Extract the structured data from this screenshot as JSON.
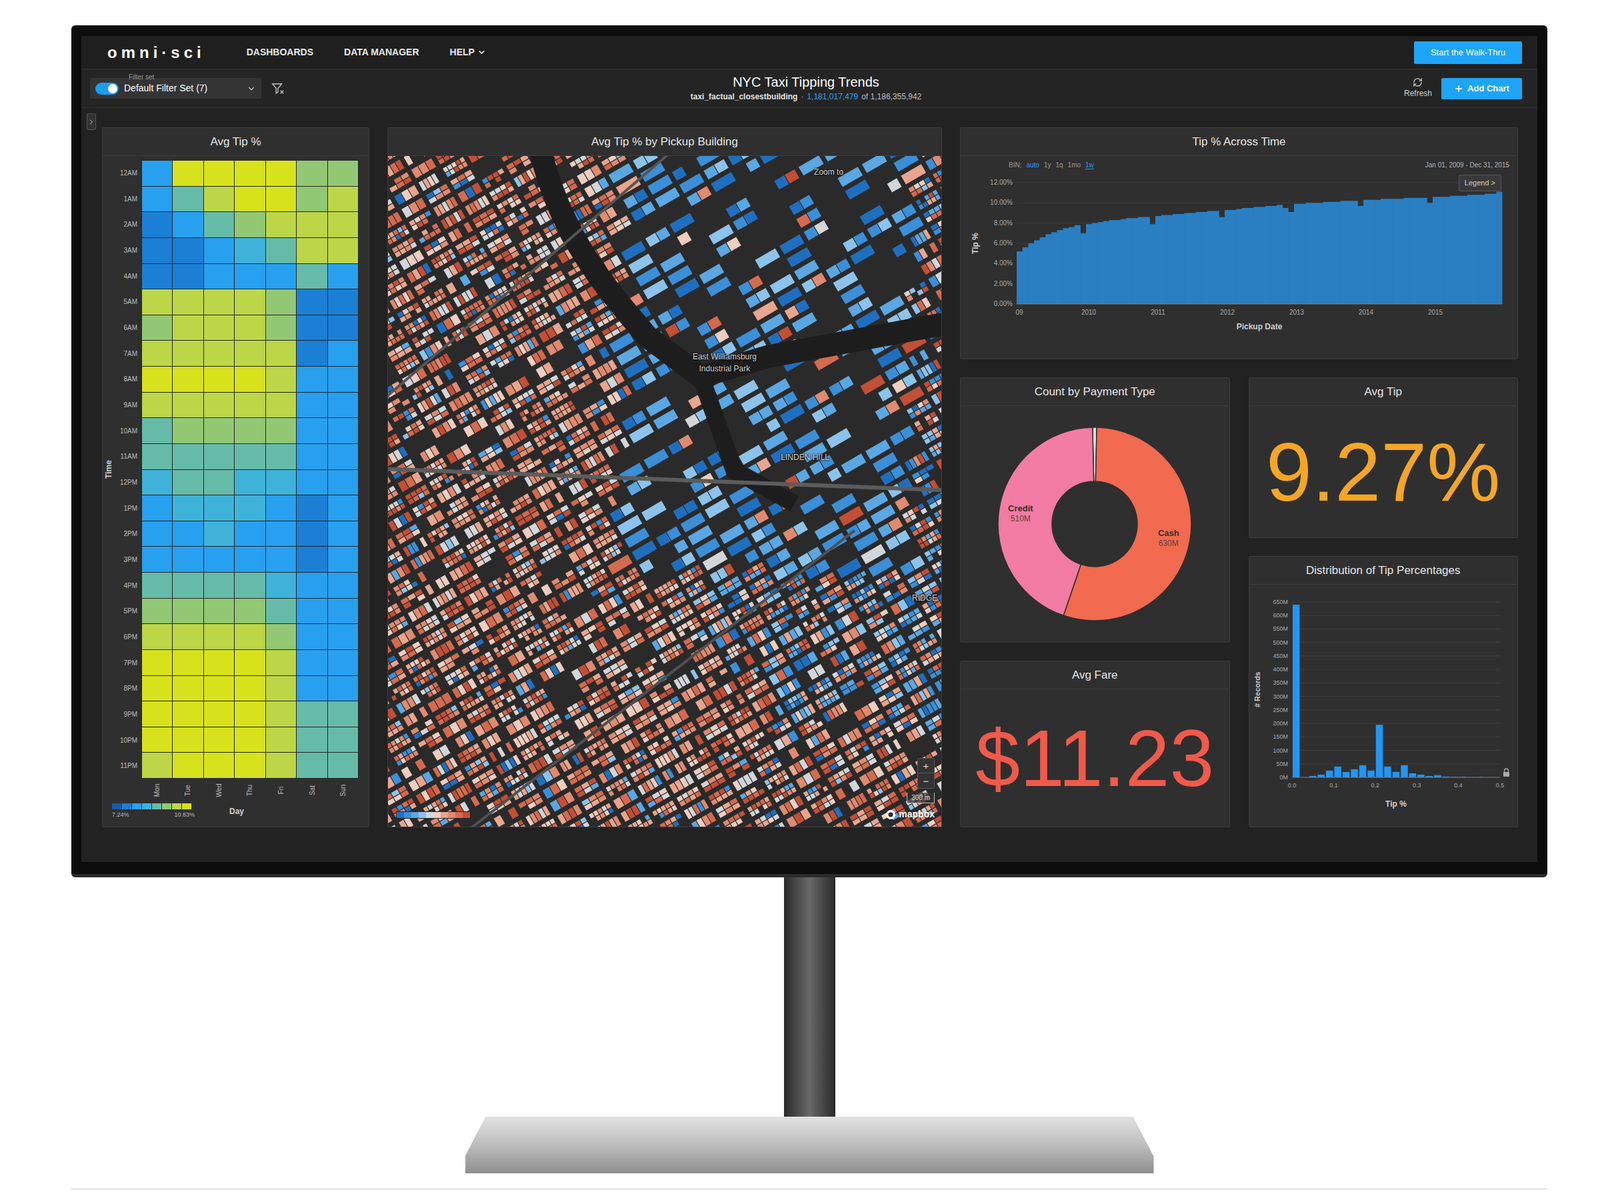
{
  "nav": {
    "logo": "omni·sci",
    "items": [
      {
        "label": "DASHBOARDS",
        "has_menu": false
      },
      {
        "label": "DATA MANAGER",
        "has_menu": false
      },
      {
        "label": "HELP",
        "has_menu": true
      }
    ],
    "walkthru_button": "Start the Walk-Thru"
  },
  "filter_bar": {
    "filter_set_label": "Filter set",
    "filter_set": "Default Filter Set (7)",
    "toggle_on": true,
    "title": "NYC Taxi Tipping Trends",
    "subtitle": {
      "table": "taxi_factual_closestbuilding",
      "separator": "·",
      "filtered": "1,181,017,479",
      "of_total": "of 1,186,355,942"
    },
    "refresh": "Refresh",
    "add_chart": "Add Chart"
  },
  "heatmap": {
    "title": "Avg Tip %",
    "y_label": "Time",
    "x_label": "Day",
    "range": [
      7.24,
      10.83
    ],
    "hours": [
      "12AM",
      "1AM",
      "2AM",
      "3AM",
      "4AM",
      "5AM",
      "6AM",
      "7AM",
      "8AM",
      "9AM",
      "10AM",
      "11AM",
      "12PM",
      "1PM",
      "2PM",
      "3PM",
      "4PM",
      "5PM",
      "6PM",
      "7PM",
      "8PM",
      "9PM",
      "10PM",
      "11PM"
    ],
    "days": [
      "Mon",
      "Tue",
      "Wed",
      "Thu",
      "Fri",
      "Sat",
      "Sun"
    ],
    "values": [
      [
        8.32,
        10.65,
        10.65,
        10.65,
        10.65,
        9.93,
        9.57
      ],
      [
        8.32,
        9.21,
        10.29,
        10.65,
        10.65,
        9.75,
        10.47
      ],
      [
        7.96,
        8.32,
        9.39,
        9.57,
        10.11,
        10.47,
        10.47
      ],
      [
        7.6,
        7.96,
        8.32,
        8.86,
        9.39,
        10.11,
        10.47
      ],
      [
        7.78,
        7.96,
        8.14,
        8.32,
        8.5,
        9.21,
        8.32
      ],
      [
        10.11,
        10.11,
        10.11,
        10.11,
        9.57,
        7.78,
        7.78
      ],
      [
        9.75,
        10.11,
        10.29,
        10.11,
        9.75,
        7.78,
        7.96
      ],
      [
        10.29,
        10.47,
        10.47,
        10.47,
        10.29,
        7.96,
        8.14
      ],
      [
        10.65,
        10.65,
        10.65,
        10.65,
        10.47,
        8.32,
        8.32
      ],
      [
        10.47,
        10.47,
        10.47,
        10.47,
        10.29,
        8.32,
        8.32
      ],
      [
        9.39,
        9.93,
        9.93,
        9.75,
        9.75,
        8.32,
        8.32
      ],
      [
        9.04,
        9.39,
        9.39,
        9.21,
        9.04,
        8.32,
        8.32
      ],
      [
        8.86,
        9.04,
        9.04,
        8.86,
        8.68,
        8.14,
        8.32
      ],
      [
        8.5,
        8.68,
        8.68,
        8.68,
        8.32,
        7.96,
        8.32
      ],
      [
        8.32,
        8.5,
        8.68,
        8.5,
        8.14,
        7.78,
        8.32
      ],
      [
        8.32,
        8.14,
        8.5,
        8.5,
        8.32,
        7.96,
        8.32
      ],
      [
        9.39,
        9.04,
        9.04,
        9.21,
        8.68,
        8.14,
        8.32
      ],
      [
        9.93,
        9.75,
        9.75,
        9.75,
        9.39,
        8.14,
        8.32
      ],
      [
        10.29,
        10.29,
        10.29,
        10.29,
        9.93,
        8.32,
        8.32
      ],
      [
        10.65,
        10.65,
        10.65,
        10.65,
        10.29,
        8.32,
        8.32
      ],
      [
        10.65,
        10.65,
        10.65,
        10.65,
        10.29,
        8.5,
        8.32
      ],
      [
        10.65,
        10.65,
        10.65,
        10.65,
        10.47,
        9.04,
        9.21
      ],
      [
        10.65,
        10.65,
        10.65,
        10.65,
        10.47,
        9.21,
        9.39
      ],
      [
        10.47,
        10.65,
        10.65,
        10.65,
        10.47,
        9.39,
        9.39
      ]
    ],
    "legend": {
      "min": "7.24%",
      "max": "10.83%",
      "colors": [
        "#155fa8",
        "#1c7fd6",
        "#27a0f0",
        "#3fb2d9",
        "#66bba8",
        "#92c874",
        "#bcd647",
        "#d7e21c"
      ]
    }
  },
  "map": {
    "title": "Avg Tip % by Pickup Building",
    "labels": [
      {
        "text": "Zoom to"
      },
      {
        "text": "East Williamsburg Industrial Park"
      },
      {
        "text": "LINDEN HILL"
      },
      {
        "text": "RIDGE"
      }
    ],
    "scale": "300 m",
    "zoom_in": "+",
    "zoom_out": "−",
    "attribution": "mapbox",
    "legend": {
      "colors": [
        "#1f6fc0",
        "#3a8fd8",
        "#5aa7e3",
        "#8cc3ec",
        "#d2d6da",
        "#f0cdbf",
        "#e9a58e",
        "#e08a70",
        "#d46a4e",
        "#c24f36"
      ]
    }
  },
  "time_chart": {
    "title": "Tip % Across Time",
    "bin_label": "BIN:",
    "bins": [
      {
        "label": "auto",
        "highlighted": true,
        "selected": false
      },
      {
        "label": "1y",
        "highlighted": false,
        "selected": false
      },
      {
        "label": "1q",
        "highlighted": false,
        "selected": false
      },
      {
        "label": "1mo",
        "highlighted": false,
        "selected": false
      },
      {
        "label": "1w",
        "highlighted": true,
        "selected": true
      }
    ],
    "date_range": "Jan 01, 2009 - Dec 31, 2015",
    "legend_button": "Legend >",
    "y_label": "Tip %",
    "x_label": "Pickup Date",
    "y_ticks": [
      "0.00%",
      "2.00%",
      "4.00%",
      "6.00%",
      "8.00%",
      "10.00%",
      "12.00%"
    ],
    "y_max": 12,
    "x_ticks": [
      "09",
      "2010",
      "2011",
      "2012",
      "2013",
      "2014",
      "2015"
    ],
    "x_span": 7,
    "series": [
      5.2,
      5.6,
      6.0,
      6.3,
      6.6,
      6.9,
      7.1,
      7.3,
      7.5,
      7.6,
      7.8,
      7.0,
      7.9,
      8.0,
      8.1,
      8.2,
      8.3,
      8.3,
      8.4,
      8.5,
      8.5,
      8.6,
      8.6,
      7.9,
      8.7,
      8.8,
      8.8,
      8.9,
      8.9,
      9.0,
      9.0,
      9.1,
      9.1,
      9.2,
      9.2,
      8.6,
      9.3,
      9.3,
      9.4,
      9.5,
      9.5,
      9.6,
      9.6,
      9.7,
      9.7,
      9.8,
      9.5,
      9.1,
      9.9,
      9.9,
      10.0,
      10.0,
      10.0,
      10.1,
      10.1,
      10.1,
      10.2,
      10.2,
      10.2,
      9.7,
      10.3,
      10.3,
      10.3,
      10.4,
      10.4,
      10.4,
      10.4,
      10.5,
      10.5,
      10.5,
      10.5,
      10.0,
      10.6,
      10.6,
      10.6,
      10.7,
      10.7,
      10.7,
      10.8,
      10.8,
      10.8,
      10.9,
      10.9,
      11.1
    ]
  },
  "payment": {
    "title": "Count by Payment Type",
    "slices": [
      {
        "value": 8,
        "color": "#dcdcdc"
      },
      {
        "label": "Cash",
        "reading": "630M",
        "value": 630,
        "color": "#f26a4f"
      },
      {
        "label": "Credit",
        "reading": "510M",
        "value": 510,
        "color": "#f27ca3"
      }
    ]
  },
  "avg_tip": {
    "title": "Avg Tip",
    "value": "9.27%"
  },
  "avg_fare": {
    "title": "Avg Fare",
    "value": "$11.23"
  },
  "histogram": {
    "title": "Distribution of Tip Percentages",
    "y_label": "# Records",
    "x_label": "Tip %",
    "y_ticks": [
      "0M",
      "50M",
      "100M",
      "150M",
      "200M",
      "250M",
      "300M",
      "350M",
      "400M",
      "450M",
      "500M",
      "550M",
      "600M",
      "650M"
    ],
    "y_max": 650,
    "x_ticks": [
      "0.0",
      "0.1",
      "0.2",
      "0.3",
      "0.4",
      "0.5"
    ],
    "values": [
      640,
      0,
      5,
      10,
      25,
      40,
      20,
      30,
      45,
      25,
      195,
      40,
      20,
      45,
      15,
      10,
      5,
      8,
      3,
      2,
      2,
      1,
      1,
      0,
      0
    ]
  }
}
